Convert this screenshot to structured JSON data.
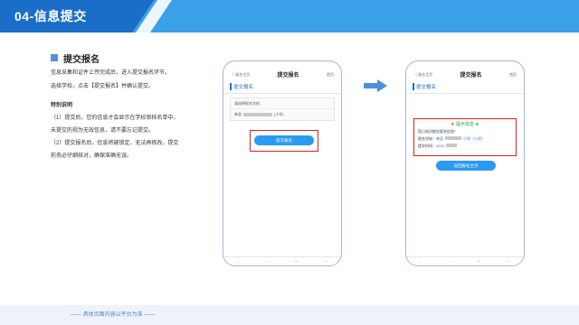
{
  "header": {
    "title": "04-信息提交"
  },
  "section": {
    "title": "提交报名",
    "intro_lines": [
      "信息采集和证件上传完成后，进入提交报名环节。",
      "选择学校，点击【提交报名】并确认提交。"
    ],
    "note_title": "特别说明",
    "note_lines": [
      "（1）提交后，您的信息才会显示在学校审核名单中，",
      "未提交的视为无效信息，请不要忘记提交。",
      "（2）提交报名后，信息将被锁定，无法再修改，提交",
      "前务必仔细核对，确保准确无误。"
    ]
  },
  "phone_left": {
    "nav_back": "〈 报名主页",
    "nav_title": "提交报名",
    "nav_right": "首页",
    "section_title": "提交报名",
    "select_label": "请选择报名学校",
    "school_prefix": "单县",
    "school_suffix": "(小学)",
    "submit_label": "提交报名"
  },
  "phone_right": {
    "nav_back": "〈 报名主页",
    "nav_title": "提交报名",
    "nav_right": "首页",
    "section_title": "提交报名",
    "result_title": "提示信息",
    "result_line1": "您已成功提交报名信息！",
    "result_school_label": "报名学校：",
    "result_school_value": "单县",
    "result_school_suffix": "小学（小学）",
    "result_time_label": "提交时间：",
    "result_time_value": "2022",
    "return_label": "返回报名主页"
  },
  "footer": {
    "text": "—— 具体页面内容以平台为准 ——"
  },
  "colors": {
    "primary": "#1a6ec8",
    "accent": "#3aa0e8",
    "highlight": "#e02020"
  }
}
